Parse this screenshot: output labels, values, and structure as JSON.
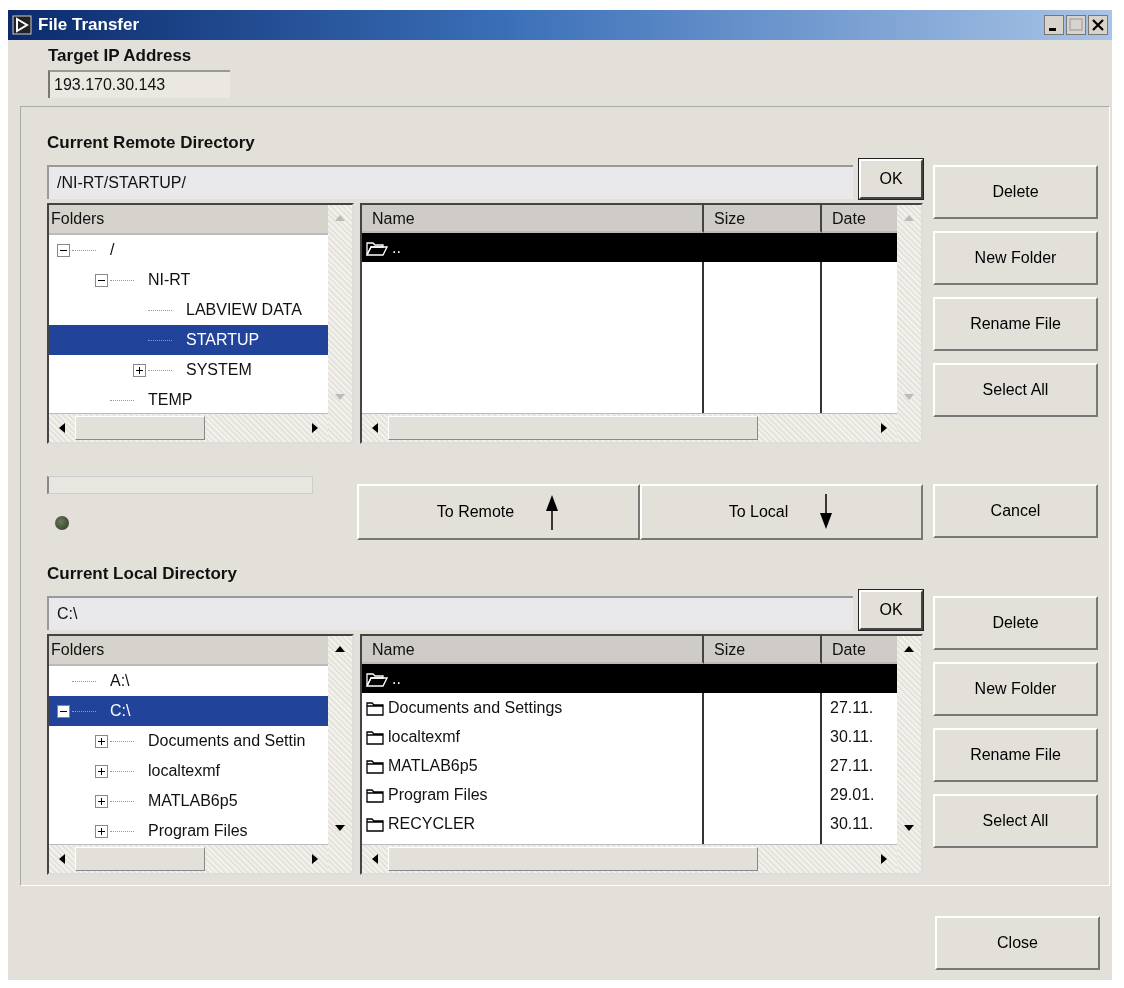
{
  "window": {
    "title": "File Transfer"
  },
  "target_ip": {
    "label": "Target IP Address",
    "value": "193.170.30.143"
  },
  "sections": [
    {
      "label": "Current Remote Directory",
      "path": "/NI-RT/STARTUP/",
      "ok": "OK",
      "tree": {
        "header": "Folders",
        "nodes": [
          {
            "label": "/",
            "selected": false,
            "expanded": true,
            "children": [
              {
                "label": "NI-RT",
                "selected": false,
                "expanded": true,
                "children": [
                  {
                    "label": "LABVIEW DATA",
                    "selected": false
                  },
                  {
                    "label": "STARTUP",
                    "selected": true
                  },
                  {
                    "label": "SYSTEM",
                    "selected": false,
                    "expanded": false
                  }
                ]
              },
              {
                "label": "TEMP",
                "selected": false
              }
            ]
          }
        ]
      },
      "list": {
        "columns": [
          "Name",
          "Size",
          "Date"
        ],
        "rows": [
          {
            "kind": "parent",
            "name": "..",
            "date": "",
            "selected": true
          }
        ]
      },
      "buttons": [
        "Delete",
        "New Folder",
        "Rename File",
        "Select All"
      ]
    },
    {
      "label": "Current Local Directory",
      "path": "C:\\",
      "ok": "OK",
      "tree": {
        "header": "Folders",
        "nodes": [
          {
            "label": "A:\\",
            "selected": false
          },
          {
            "label": "C:\\",
            "selected": true,
            "expanded": true,
            "children": [
              {
                "label": "Documents and Settin",
                "selected": false,
                "expanded": false
              },
              {
                "label": "localtexmf",
                "selected": false,
                "expanded": false
              },
              {
                "label": "MATLAB6p5",
                "selected": false,
                "expanded": false
              },
              {
                "label": "Program Files",
                "selected": false,
                "expanded": false
              }
            ]
          }
        ]
      },
      "list": {
        "columns": [
          "Name",
          "Size",
          "Date"
        ],
        "rows": [
          {
            "kind": "parent",
            "name": "..",
            "date": "",
            "selected": true
          },
          {
            "kind": "folder",
            "name": "Documents and Settings",
            "date": "27.11.",
            "selected": false
          },
          {
            "kind": "folder",
            "name": "localtexmf",
            "date": "30.11.",
            "selected": false
          },
          {
            "kind": "folder",
            "name": "MATLAB6p5",
            "date": "27.11.",
            "selected": false
          },
          {
            "kind": "folder",
            "name": "Program Files",
            "date": "29.01.",
            "selected": false
          },
          {
            "kind": "folder",
            "name": "RECYCLER",
            "date": "30.11.",
            "selected": false
          }
        ]
      },
      "buttons": [
        "Delete",
        "New Folder",
        "Rename File",
        "Select All"
      ]
    }
  ],
  "progress": {
    "level": 0
  },
  "indicator": {
    "on": false
  },
  "transfer_buttons": [
    {
      "label": "To Remote",
      "kind": "up"
    },
    {
      "label": "To Local",
      "kind": "down"
    }
  ],
  "cancel": "Cancel",
  "close": "Close"
}
